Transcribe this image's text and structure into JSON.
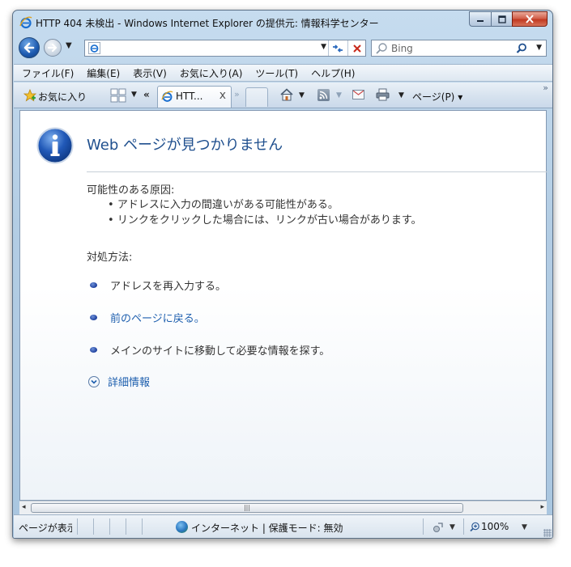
{
  "window": {
    "title": "HTTP 404 未検出 - Windows Internet Explorer の提供元:  情報科学センター"
  },
  "navigation": {
    "address_value": "",
    "search_placeholder": "Bing"
  },
  "menu": {
    "items": [
      "ファイル(F)",
      "編集(E)",
      "表示(V)",
      "お気に入り(A)",
      "ツール(T)",
      "ヘルプ(H)"
    ]
  },
  "commandbar": {
    "favorites_label": "お気に入り",
    "tab_label": "HTT...",
    "tab_close": "x",
    "page_menu_label": "ページ(P)"
  },
  "content": {
    "title": "Web ページが見つかりません",
    "causes_heading": "可能性のある原因:",
    "causes": [
      "アドレスに入力の間違いがある可能性がある。",
      "リンクをクリックした場合には、リンクが古い場合があります。"
    ],
    "actions_heading": "対処方法:",
    "actions": [
      {
        "text": "アドレスを再入力する。",
        "link": false
      },
      {
        "text": "前のページに戻る。",
        "link": true
      },
      {
        "text": "メインのサイトに移動して必要な情報を探す。",
        "link": false
      }
    ],
    "more_info_label": "詳細情報"
  },
  "statusbar": {
    "status_text": "ページが表示されました",
    "zone_text": "インターネット | 保護モード: 無効",
    "zoom_text": "100%"
  },
  "colors": {
    "title_blue": "#1f4f8e",
    "link_blue": "#1e5fae",
    "close_red": "#c13a22"
  },
  "icons": {
    "title": "ie-logo-icon",
    "back": "back-arrow-icon",
    "forward": "forward-arrow-icon",
    "refresh": "refresh-icon",
    "stop": "stop-x-icon",
    "search": "magnifier-icon",
    "favorites": "star-icon",
    "home": "home-icon",
    "feeds": "feed-icon",
    "mail": "mail-icon",
    "print": "printer-icon",
    "info": "info-icon",
    "zone": "globe-icon",
    "zoom": "zoom-icon"
  }
}
